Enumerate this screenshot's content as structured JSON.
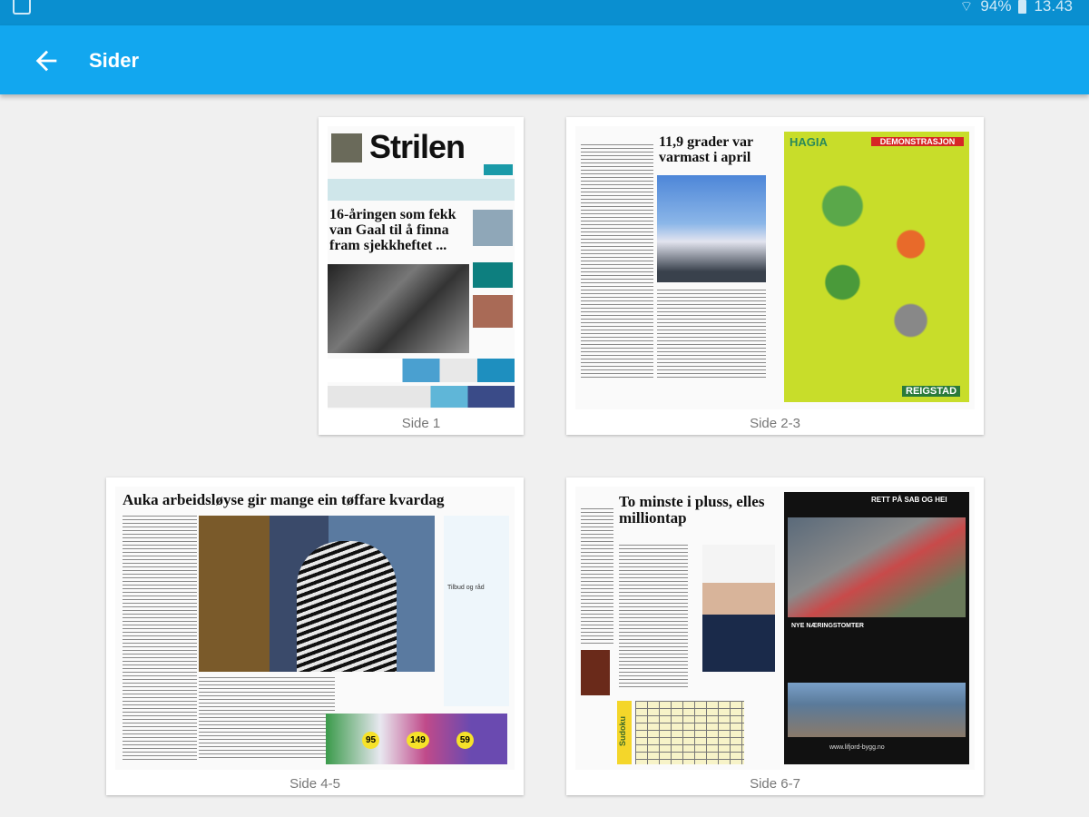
{
  "status_bar": {
    "battery": "94%",
    "time": "13.43"
  },
  "app_bar": {
    "title": "Sider",
    "back_icon": "arrow-left-icon"
  },
  "pages": [
    {
      "label": "Side 1",
      "masthead": "Strilen",
      "headline": "16-åringen som fekk van Gaal til å finna fram sjekkheftet ..."
    },
    {
      "label": "Side 2-3",
      "headline": "11,9 grader var varmast i april",
      "ad_brand": "HAGIA",
      "ad_banner": "DEMONSTRASJON",
      "ad_footer": "REIGSTAD"
    },
    {
      "label": "Side 4-5",
      "headline": "Auka arbeidsløyse gir mange ein tøffare kvardag",
      "sub_heading": "Tilbud og råd",
      "prices": [
        "95",
        "149",
        "59"
      ]
    },
    {
      "label": "Side 6-7",
      "headline": "To minste i pluss, elles milliontap",
      "puzzle_title": "Sudoku",
      "ad_title": "RETT PÅ SAB OG HEI",
      "ad_subtitle": "NYE NÆRINGSTOMTER",
      "ad_url": "www.lifjord-bygg.no"
    }
  ],
  "colors": {
    "status_bar": "#0a8fd0",
    "app_bar": "#12a7ef",
    "background": "#f0f0f0",
    "ad_lime": "#c8dd2a"
  }
}
